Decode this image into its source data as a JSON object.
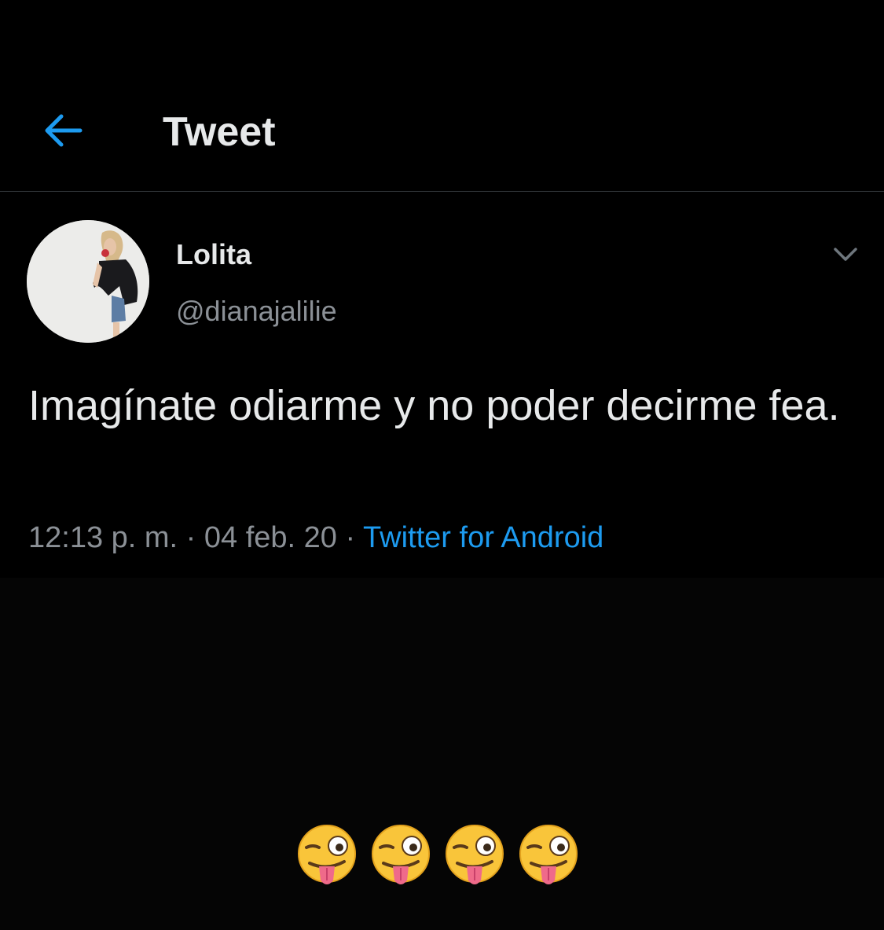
{
  "header": {
    "back_icon": "arrow-left-icon",
    "title": "Tweet"
  },
  "tweet": {
    "author": {
      "display_name": "Lolita",
      "handle": "@dianajalilie",
      "avatar_icon": "profile-photo"
    },
    "more_icon": "chevron-down-icon",
    "text": "Imagínate odiarme y no poder decirme fea.",
    "time": "12:13 p. m.",
    "separator_1": " · ",
    "date": "04 feb. 20",
    "separator_2": " · ",
    "source": "Twitter for Android"
  },
  "caption_emojis": [
    "winking-face-with-tongue",
    "winking-face-with-tongue",
    "winking-face-with-tongue",
    "winking-face-with-tongue"
  ],
  "colors": {
    "background": "#000000",
    "text_primary": "#e7e9ea",
    "text_secondary": "#8b9096",
    "accent": "#1d9bf0",
    "divider": "#2f3336"
  }
}
